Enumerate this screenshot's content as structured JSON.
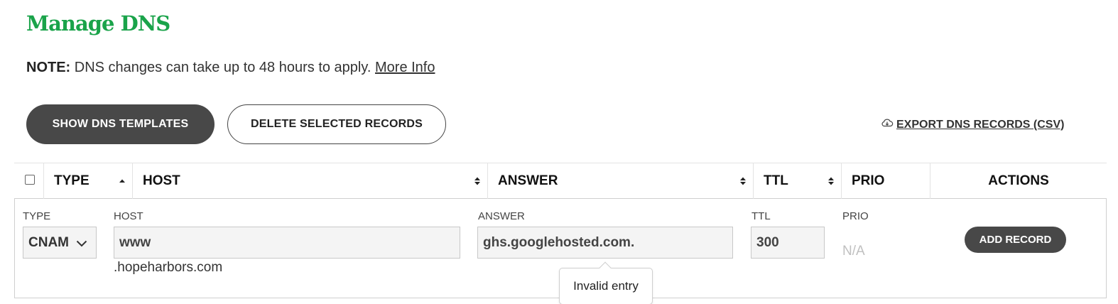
{
  "page": {
    "title": "Manage DNS",
    "note_label": "NOTE:",
    "note_text": " DNS changes can take up to 48 hours to apply. ",
    "note_link": "More Info"
  },
  "toolbar": {
    "show_templates_label": "SHOW DNS TEMPLATES",
    "delete_selected_label": "DELETE SELECTED RECORDS",
    "export_label": " EXPORT DNS RECORDS (CSV)"
  },
  "table": {
    "columns": [
      {
        "label": "TYPE",
        "sort": "ascending"
      },
      {
        "label": "HOST",
        "sort": "both"
      },
      {
        "label": "ANSWER",
        "sort": "both"
      },
      {
        "label": "TTL",
        "sort": "both"
      },
      {
        "label": "PRIO",
        "sort": "none"
      },
      {
        "label": "ACTIONS",
        "sort": "none"
      }
    ]
  },
  "edit_row": {
    "type_label": "TYPE",
    "type_value": "CNAM",
    "host_label": "HOST",
    "host_value": "www",
    "host_suffix": ".hopeharbors.com",
    "answer_label": "ANSWER",
    "answer_value": "ghs.googlehosted.com.",
    "ttl_label": "TTL",
    "ttl_value": "300",
    "prio_label": "PRIO",
    "prio_value": "N/A",
    "add_record_label": "ADD RECORD",
    "tooltip_text": "Invalid entry"
  },
  "colors": {
    "brand_green": "#1aa34a",
    "dark_button": "#484848"
  }
}
